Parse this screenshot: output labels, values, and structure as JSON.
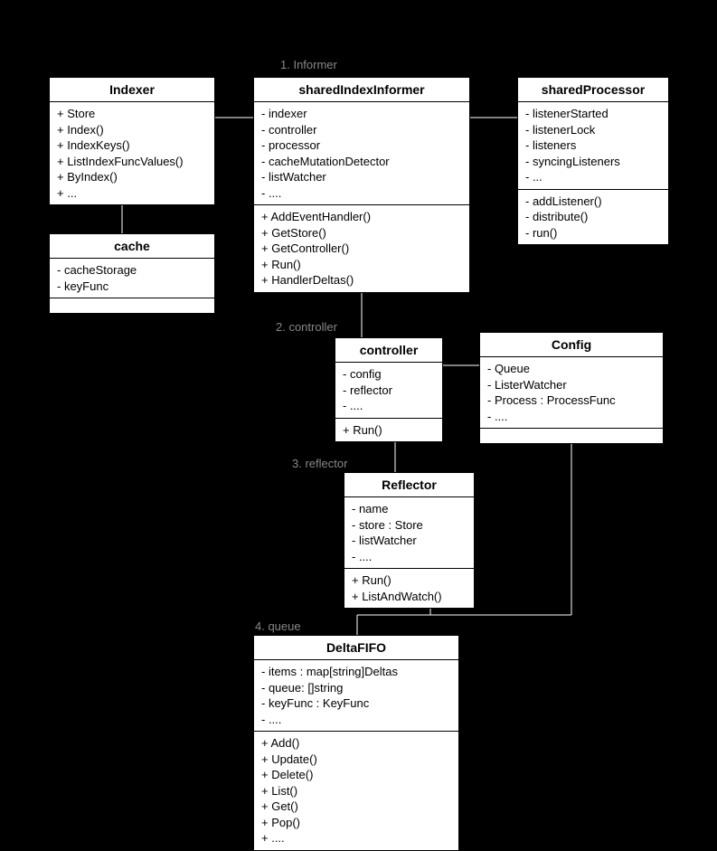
{
  "labels": {
    "informer": "1. Informer",
    "controller": "2. controller",
    "reflector": "3. reflector",
    "queue": "4. queue"
  },
  "indexer": {
    "title": "Indexer",
    "attrs": "+ Store\n+ Index()\n+ IndexKeys()\n+ ListIndexFuncValues()\n+ ByIndex()\n+ ..."
  },
  "sharedIndexInformer": {
    "title": "sharedIndexInformer",
    "attrs": "- indexer\n- controller\n- processor\n- cacheMutationDetector\n- listWatcher\n- ....",
    "ops": "+ AddEventHandler()\n+ GetStore()\n+ GetController()\n+ Run()\n+ HandlerDeltas()"
  },
  "sharedProcessor": {
    "title": "sharedProcessor",
    "attrs": "- listenerStarted\n- listenerLock\n- listeners\n- syncingListeners\n- ...",
    "ops": "- addListener()\n- distribute()\n- run()"
  },
  "cache": {
    "title": "cache",
    "attrs": "- cacheStorage\n- keyFunc"
  },
  "controllerBox": {
    "title": "controller",
    "attrs": "- config\n- reflector\n- ....",
    "ops": "+ Run()"
  },
  "config": {
    "title": "Config",
    "attrs": "- Queue\n- ListerWatcher\n- Process : ProcessFunc\n- ...."
  },
  "reflector": {
    "title": "Reflector",
    "attrs": "- name\n- store : Store\n- listWatcher\n- ....",
    "ops": "+ Run()\n+ ListAndWatch()"
  },
  "deltaFifo": {
    "title": "DeltaFIFO",
    "attrs": "- items : map[string]Deltas\n- queue: []string\n- keyFunc : KeyFunc\n- ....",
    "ops": "+ Add()\n+ Update()\n+ Delete()\n+ List()\n+ Get()\n+ Pop()\n+ ...."
  }
}
